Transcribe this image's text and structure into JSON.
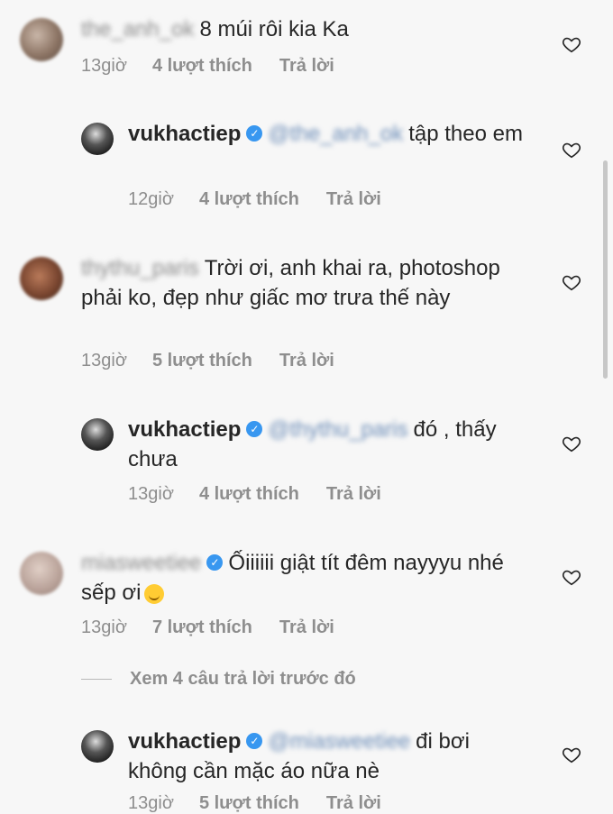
{
  "comments": [
    {
      "username": "the_anh_ok",
      "verified": false,
      "text": "8 múi rôi kia Ka",
      "time": "13giờ",
      "likes": "4 lượt thích",
      "reply": "Trả lời"
    },
    {
      "username": "vukhactiep",
      "verified": true,
      "mention": "@the_anh_ok",
      "text": "tập theo em",
      "time": "12giờ",
      "likes": "4 lượt thích",
      "reply": "Trả lời"
    },
    {
      "username": "thythu_paris",
      "verified": false,
      "text": "Trời ơi, anh khai ra, photoshop phải ko, đẹp như giấc mơ trưa thế này",
      "time": "13giờ",
      "likes": "5 lượt thích",
      "reply": "Trả lời"
    },
    {
      "username": "vukhactiep",
      "verified": true,
      "mention": "@thythu_paris",
      "text": "đó , thấy chưa",
      "time": "13giờ",
      "likes": "4 lượt thích",
      "reply": "Trả lời"
    },
    {
      "username": "miasweetiee",
      "verified": true,
      "text": "Ốiiiiii giật tít đêm nayyyu nhé sếp ơi",
      "time": "13giờ",
      "likes": "7 lượt thích",
      "reply": "Trả lời"
    },
    {
      "username": "vukhactiep",
      "verified": true,
      "mention": "@miasweetiee",
      "text": "đi bơi không cần mặc áo nữa nè",
      "time": "13giờ",
      "likes": "5 lượt thích",
      "reply": "Trả lời"
    }
  ],
  "view_previous": "Xem 4 câu trả lời trước đó",
  "icons": {
    "like": "heart-outline-icon",
    "verified": "verified-badge-icon",
    "emoji": "drooling-face-emoji"
  },
  "colors": {
    "background": "#f7f7f7",
    "text": "#262626",
    "meta": "#8e8e8e",
    "verified": "#3897f0"
  }
}
